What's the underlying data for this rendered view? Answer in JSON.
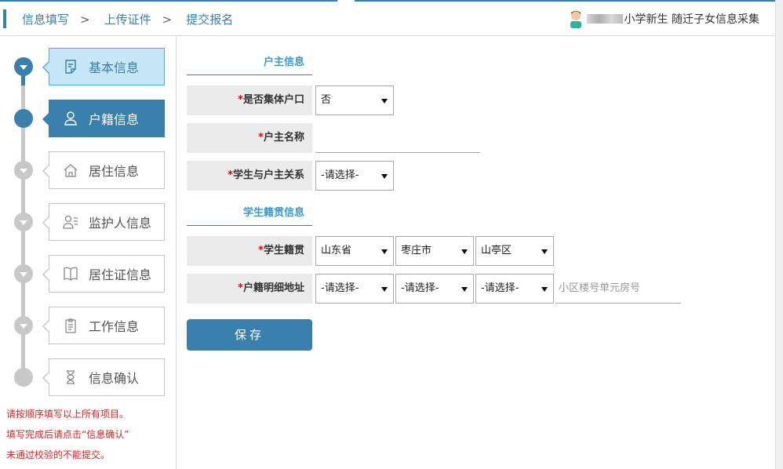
{
  "breadcrumb": [
    "信息填写",
    "上传证件",
    "提交报名"
  ],
  "breadcrumb_sep": ">",
  "user": {
    "system_title": "小学新生 随迁子女信息采集"
  },
  "steps": [
    {
      "label": "基本信息",
      "icon": "form-icon",
      "state": "done"
    },
    {
      "label": "户籍信息",
      "icon": "person-icon",
      "state": "active"
    },
    {
      "label": "居住信息",
      "icon": "house-icon",
      "state": "pending"
    },
    {
      "label": "监护人信息",
      "icon": "guardian-icon",
      "state": "pending"
    },
    {
      "label": "居住证信息",
      "icon": "book-icon",
      "state": "pending"
    },
    {
      "label": "工作信息",
      "icon": "clipboard-icon",
      "state": "pending"
    },
    {
      "label": "信息确认",
      "icon": "hourglass-icon",
      "state": "pending"
    }
  ],
  "notes": [
    "请按顺序填写以上所有项目。",
    "填写完成后请点击“信息确认”",
    "未通过校验的不能提交。"
  ],
  "form": {
    "section_household": "户主信息",
    "section_native": "学生籍贯信息",
    "required_mark": "*",
    "collective": {
      "label": "是否集体户口",
      "value": "否"
    },
    "householder_name": {
      "label": "户主名称",
      "value": ""
    },
    "relation": {
      "label": "学生与户主关系",
      "value": "-请选择-"
    },
    "native_place": {
      "label": "学生籍贯",
      "province": "山东省",
      "city": "枣庄市",
      "district": "山亭区"
    },
    "address": {
      "label": "户籍明细地址",
      "province": "-请选择-",
      "city": "-请选择-",
      "district": "-请选择-",
      "detail_placeholder": "小区楼号单元房号"
    },
    "save_label": "保存"
  },
  "colors": {
    "accent": "#3a80ad",
    "done_bg": "#c5e7f7",
    "required": "#e00000",
    "note": "#e02020"
  }
}
